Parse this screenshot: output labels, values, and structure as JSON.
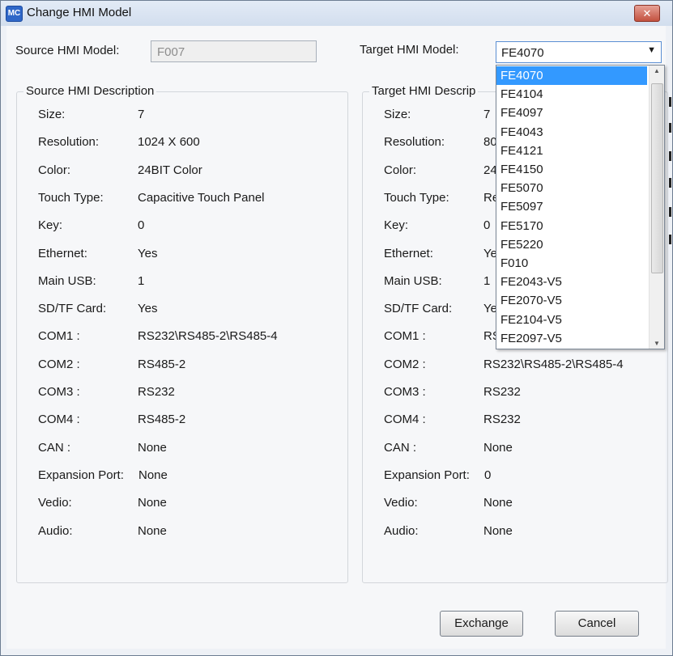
{
  "window": {
    "title": "Change HMI Model",
    "icon_text": "MC",
    "close_label": "✕"
  },
  "source_model": {
    "label": "Source HMI Model:",
    "value": "F007"
  },
  "target_model": {
    "label": "Target HMI Model:",
    "value": "FE4070",
    "arrow": "▼"
  },
  "source_desc": {
    "title": "Source HMI Description",
    "rows": [
      {
        "label": "Size:",
        "value": "7"
      },
      {
        "label": "Resolution:",
        "value": "1024 X 600"
      },
      {
        "label": "Color:",
        "value": "24BIT Color"
      },
      {
        "label": "Touch Type:",
        "value": "Capacitive Touch Panel"
      },
      {
        "label": "Key:",
        "value": "0"
      },
      {
        "label": "Ethernet:",
        "value": "Yes"
      },
      {
        "label": "Main USB:",
        "value": "1"
      },
      {
        "label": "SD/TF Card:",
        "value": "Yes"
      },
      {
        "label": "COM1 :",
        "value": "RS232\\RS485-2\\RS485-4"
      },
      {
        "label": "COM2 :",
        "value": "RS485-2"
      },
      {
        "label": "COM3 :",
        "value": "RS232"
      },
      {
        "label": "COM4 :",
        "value": "RS485-2"
      },
      {
        "label": "CAN :",
        "value": "None"
      },
      {
        "label": "Expansion Port:",
        "value": "None"
      },
      {
        "label": "Vedio:",
        "value": "None"
      },
      {
        "label": "Audio:",
        "value": "None"
      }
    ]
  },
  "target_desc": {
    "title": "Target HMI Descrip",
    "rows": [
      {
        "label": "Size:",
        "value": "7"
      },
      {
        "label": "Resolution:",
        "value": "80"
      },
      {
        "label": "Color:",
        "value": "24"
      },
      {
        "label": "Touch Type:",
        "value": "Re"
      },
      {
        "label": "Key:",
        "value": "0"
      },
      {
        "label": "Ethernet:",
        "value": "Ye"
      },
      {
        "label": "Main USB:",
        "value": "1"
      },
      {
        "label": "SD/TF Card:",
        "value": "Ye"
      },
      {
        "label": "COM1 :",
        "value": "RS"
      },
      {
        "label": "COM2 :",
        "value": "RS232\\RS485-2\\RS485-4"
      },
      {
        "label": "COM3 :",
        "value": "RS232"
      },
      {
        "label": "COM4 :",
        "value": "RS232"
      },
      {
        "label": "CAN :",
        "value": "None"
      },
      {
        "label": "Expansion Port:",
        "value": "0"
      },
      {
        "label": "Vedio:",
        "value": "None"
      },
      {
        "label": "Audio:",
        "value": "None"
      }
    ]
  },
  "dropdown": {
    "options": [
      "FE4070",
      "FE4104",
      "FE4097",
      "FE4043",
      "FE4121",
      "FE4150",
      "FE5070",
      "FE5097",
      "FE5170",
      "FE5220",
      "F010",
      "FE2043-V5",
      "FE2070-V5",
      "FE2104-V5",
      "FE2097-V5"
    ],
    "selected_index": 0,
    "scroll_up": "▲",
    "scroll_down": "▼"
  },
  "buttons": {
    "exchange": "Exchange",
    "cancel": "Cancel"
  },
  "colors": {
    "selection": "#3399ff",
    "close": "#c3513f",
    "title_bar": "#d8e3f1"
  }
}
